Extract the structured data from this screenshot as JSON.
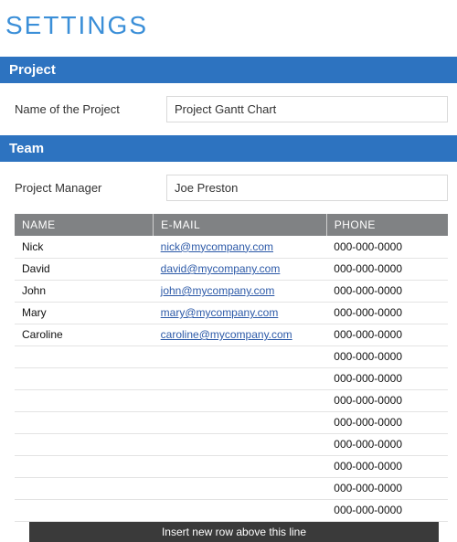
{
  "page_title": "SETTINGS",
  "sections": {
    "project": {
      "header": "Project",
      "name_label": "Name of the Project",
      "name_value": "Project Gantt Chart"
    },
    "team": {
      "header": "Team",
      "manager_label": "Project Manager",
      "manager_value": "Joe Preston",
      "table": {
        "headers": {
          "name": "NAME",
          "email": "E-MAIL",
          "phone": "PHONE"
        },
        "rows": [
          {
            "name": "Nick",
            "email": "nick@mycompany.com",
            "phone": "000-000-0000"
          },
          {
            "name": "David",
            "email": "david@mycompany.com",
            "phone": "000-000-0000"
          },
          {
            "name": "John",
            "email": "john@mycompany.com",
            "phone": "000-000-0000"
          },
          {
            "name": "Mary",
            "email": "mary@mycompany.com",
            "phone": "000-000-0000"
          },
          {
            "name": "Caroline",
            "email": "caroline@mycompany.com",
            "phone": "000-000-0000"
          },
          {
            "name": "",
            "email": "",
            "phone": "000-000-0000"
          },
          {
            "name": "",
            "email": "",
            "phone": "000-000-0000"
          },
          {
            "name": "",
            "email": "",
            "phone": "000-000-0000"
          },
          {
            "name": "",
            "email": "",
            "phone": "000-000-0000"
          },
          {
            "name": "",
            "email": "",
            "phone": "000-000-0000"
          },
          {
            "name": "",
            "email": "",
            "phone": "000-000-0000"
          },
          {
            "name": "",
            "email": "",
            "phone": "000-000-0000"
          },
          {
            "name": "",
            "email": "",
            "phone": "000-000-0000"
          }
        ],
        "footer": "Insert new row above this line"
      }
    }
  }
}
